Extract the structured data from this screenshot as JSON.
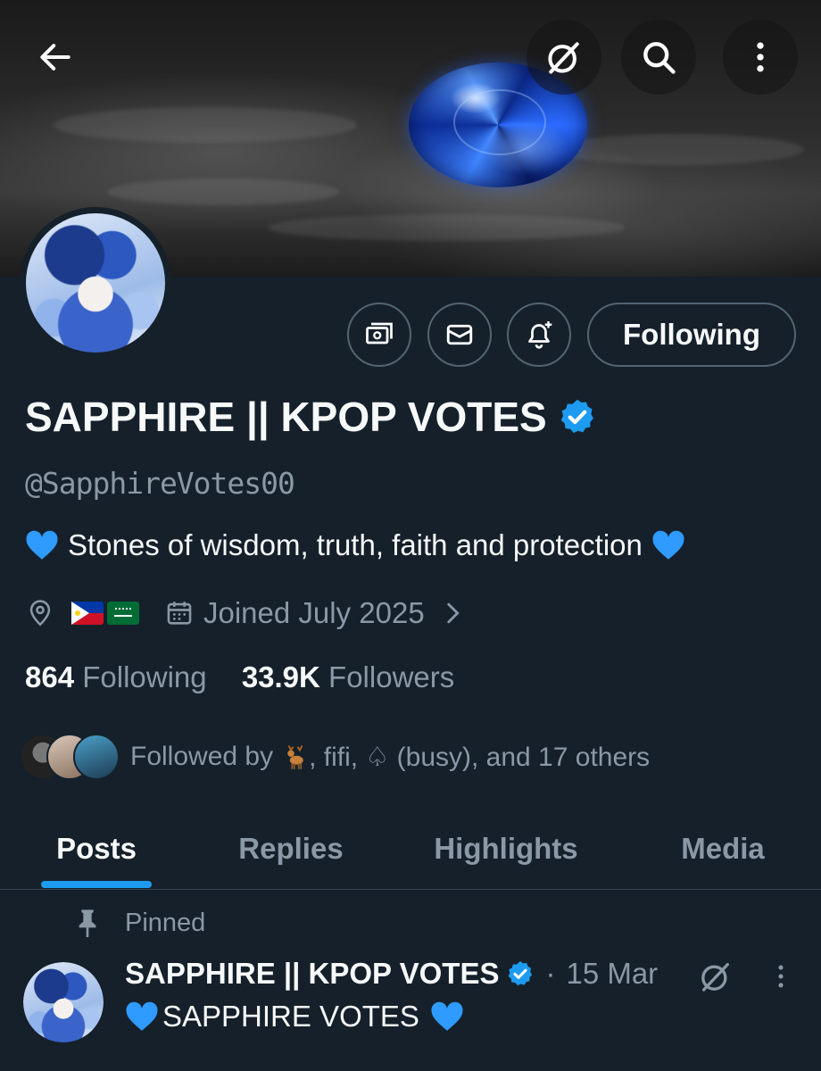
{
  "header": {
    "back_icon": "arrow-left-icon",
    "grok_icon": "grok-icon",
    "search_icon": "search-icon",
    "more_icon": "more-vertical-icon"
  },
  "profile": {
    "display_name": "SAPPHIRE || KPOP VOTES",
    "handle": "@SapphireVotes00",
    "bio": "Stones of wisdom, truth, faith and protection",
    "verified_color": "#1d9bf0",
    "location_flags": [
      "philippines-flag",
      "saudi-arabia-flag"
    ],
    "joined": "Joined July 2025",
    "following_count": "864",
    "following_label": "Following",
    "followers_count": "33.9K",
    "followers_label": "Followers",
    "followed_by_prefix": "Followed by",
    "followed_by_rest": ", fifi, ♤ (busy), and 17 others"
  },
  "actions": {
    "subscribe_icon": "money-icon",
    "message_icon": "mail-icon",
    "notify_icon": "bell-plus-icon",
    "following_label": "Following"
  },
  "tabs": [
    {
      "label": "Posts",
      "active": true
    },
    {
      "label": "Replies",
      "active": false
    },
    {
      "label": "Highlights",
      "active": false
    },
    {
      "label": "Media",
      "active": false
    }
  ],
  "pinned_post": {
    "pinned_label": "Pinned",
    "author": "SAPPHIRE || KPOP VOTES",
    "separator": "·",
    "date": "15 Mar",
    "text": "SAPPHIRE VOTES"
  },
  "colors": {
    "background": "#15202b",
    "accent": "#1d9bf0",
    "muted_text": "#8b98a5",
    "border": "#536471",
    "heart": "#2f9bff"
  }
}
